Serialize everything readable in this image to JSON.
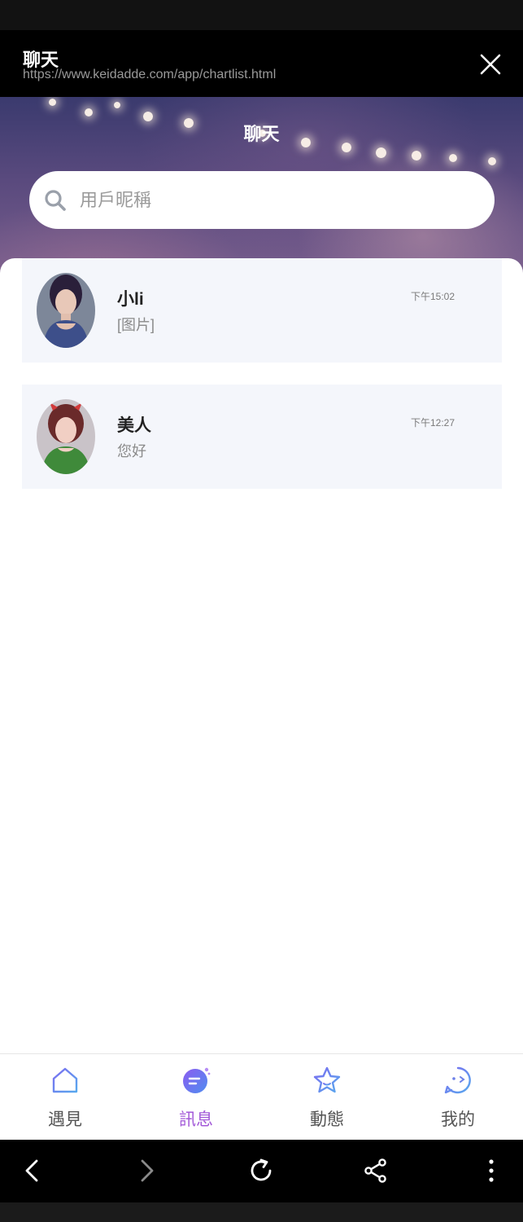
{
  "browser": {
    "title": "聊天",
    "url": "https://www.keidadde.com/app/chartlist.html",
    "close_icon": "close-icon"
  },
  "page": {
    "title": "聊天",
    "search": {
      "placeholder": "用戶昵稱",
      "value": ""
    }
  },
  "chats": [
    {
      "name": "小li",
      "message": "[图片]",
      "time": "下午15:02"
    },
    {
      "name": "美人",
      "message": "您好",
      "time": "下午12:27"
    }
  ],
  "tabs": [
    {
      "label": "遇見",
      "icon": "home-icon",
      "active": false
    },
    {
      "label": "訊息",
      "icon": "message-icon",
      "active": true
    },
    {
      "label": "動態",
      "icon": "star-icon",
      "active": false
    },
    {
      "label": "我的",
      "icon": "face-icon",
      "active": false
    }
  ],
  "nav": [
    "back-icon",
    "forward-icon",
    "reload-icon",
    "share-icon",
    "more-icon"
  ],
  "colors": {
    "accent": "#a35ad8",
    "icon_blue": "#6b7fe8",
    "item_bg": "#f4f6fb"
  }
}
